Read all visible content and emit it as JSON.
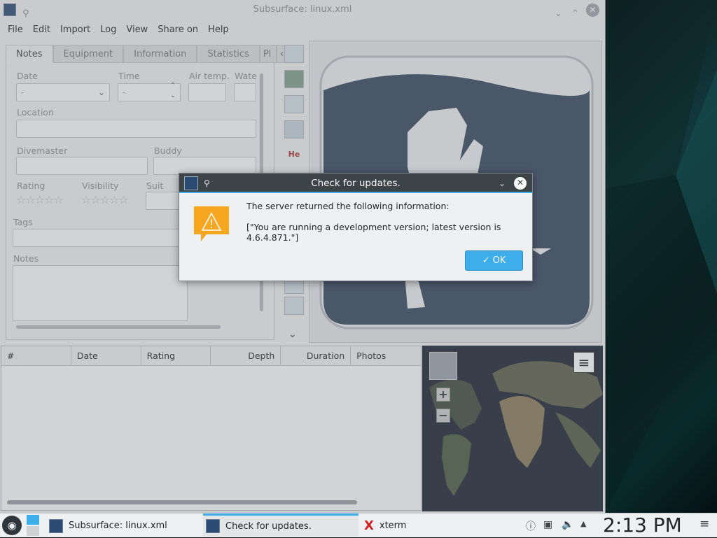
{
  "window": {
    "title": "Subsurface: linux.xml",
    "controls": [
      "chevron-down",
      "chevron-up",
      "close"
    ]
  },
  "menu": [
    "File",
    "Edit",
    "Import",
    "Log",
    "View",
    "Share on",
    "Help"
  ],
  "tabs": [
    "Notes",
    "Equipment",
    "Information",
    "Statistics",
    "Pl"
  ],
  "notes": {
    "date_label": "Date",
    "date_value": "-",
    "time_label": "Time",
    "time_value": "-",
    "airtemp_label": "Air temp.",
    "water_label": "Wate",
    "location_label": "Location",
    "divemaster_label": "Divemaster",
    "buddy_label": "Buddy",
    "rating_label": "Rating",
    "visibility_label": "Visibility",
    "suit_label": "Suit",
    "tags_label": "Tags",
    "notes_label": "Notes",
    "rating_stars": "☆☆☆☆☆",
    "visibility_stars": "☆☆☆☆☆"
  },
  "toolbar": {
    "he_label": "He"
  },
  "divelist": {
    "columns": [
      "#",
      "Date",
      "Rating",
      "Depth",
      "Duration",
      "Photos"
    ]
  },
  "map": {
    "zoom_in": "+",
    "zoom_out": "−",
    "menu_icon": "≡"
  },
  "dialog": {
    "title": "Check for updates.",
    "line1": "The server returned the following information:",
    "line2": "[\"You are running a development version; latest version is 4.6.4.871.\"]",
    "ok_label": "OK"
  },
  "taskbar": {
    "tasks": [
      "Subsurface: linux.xml",
      "Check for updates.",
      "xterm"
    ],
    "clock": "2:13 PM",
    "xterm_icon_glyph": "X"
  },
  "colors": {
    "accent": "#3daee9",
    "dialog_title": "#3d4448",
    "warning": "#f6a71f"
  }
}
